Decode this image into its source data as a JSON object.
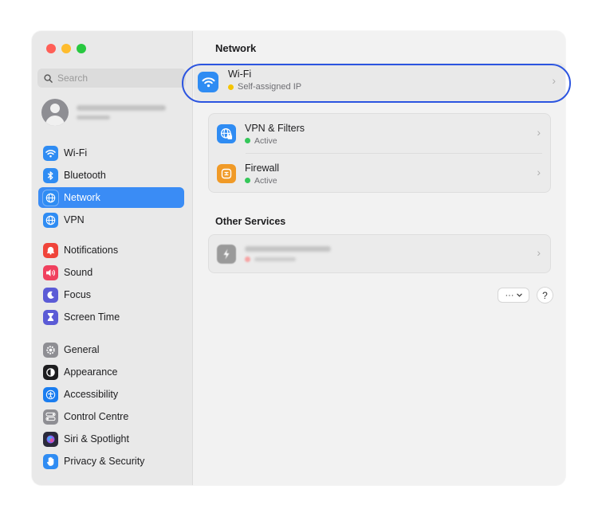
{
  "window": {
    "controls": [
      "close",
      "minimize",
      "zoom"
    ]
  },
  "sidebar": {
    "search": {
      "placeholder": "Search"
    },
    "groups": [
      [
        {
          "label": "Wi-Fi",
          "icon": "wifi-icon",
          "color": "#2f8cf3"
        },
        {
          "label": "Bluetooth",
          "icon": "bluetooth-icon",
          "color": "#2f8cf3"
        },
        {
          "label": "Network",
          "icon": "globe-icon",
          "color": "#2f8cf3",
          "active": true
        },
        {
          "label": "VPN",
          "icon": "globe-icon",
          "color": "#2f8cf3"
        }
      ],
      [
        {
          "label": "Notifications",
          "icon": "bell-icon",
          "color": "#f0443a"
        },
        {
          "label": "Sound",
          "icon": "speaker-icon",
          "color": "#f0405e"
        },
        {
          "label": "Focus",
          "icon": "moon-icon",
          "color": "#5b5bd6"
        },
        {
          "label": "Screen Time",
          "icon": "hourglass-icon",
          "color": "#5b5bd6"
        }
      ],
      [
        {
          "label": "General",
          "icon": "gear-icon",
          "color": "#8e8e93"
        },
        {
          "label": "Appearance",
          "icon": "appearance-icon",
          "color": "#1d1d1f"
        },
        {
          "label": "Accessibility",
          "icon": "accessibility-icon",
          "color": "#1a7df0"
        },
        {
          "label": "Control Centre",
          "icon": "toggles-icon",
          "color": "#8e8e93"
        },
        {
          "label": "Siri & Spotlight",
          "icon": "siri-icon",
          "color": "#2a2a3a"
        },
        {
          "label": "Privacy & Security",
          "icon": "hand-icon",
          "color": "#2f8cf3"
        }
      ]
    ]
  },
  "main": {
    "title": "Network",
    "wifi": {
      "label": "Wi-Fi",
      "status": "Self-assigned IP",
      "status_color": "#f5c400"
    },
    "services": [
      {
        "label": "VPN & Filters",
        "status": "Active",
        "status_color": "#34c759",
        "icon": "globe-lock-icon",
        "color": "#2f8cf3"
      },
      {
        "label": "Firewall",
        "status": "Active",
        "status_color": "#34c759",
        "icon": "firewall-icon",
        "color": "#f09a27"
      }
    ],
    "other_services_title": "Other Services",
    "more_button_label": "···",
    "help_label": "?"
  }
}
